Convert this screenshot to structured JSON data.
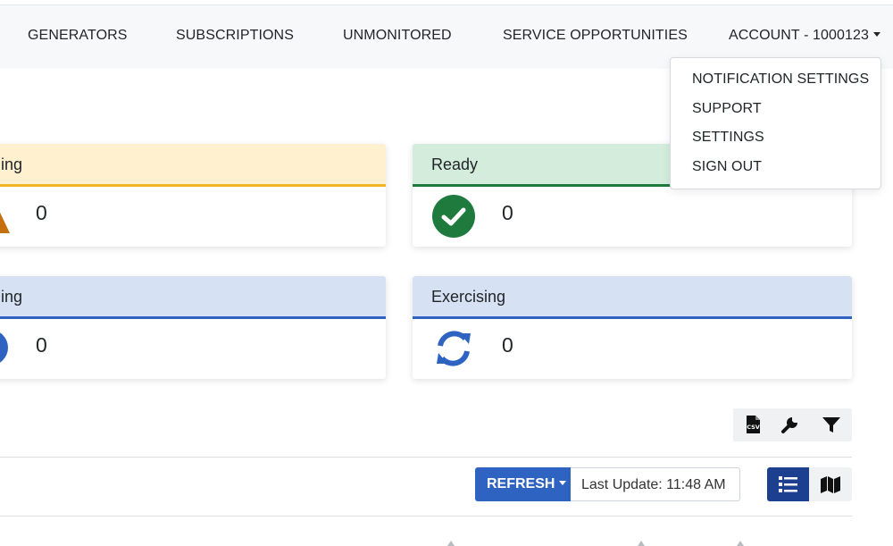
{
  "nav": {
    "generators": "GENERATORS",
    "subscriptions": "SUBSCRIPTIONS",
    "unmonitored": "UNMONITORED",
    "service_opportunities": "SERVICE OPPORTUNITIES",
    "account": "ACCOUNT - 1000123"
  },
  "account_menu": {
    "items": [
      "NOTIFICATION SETTINGS",
      "SUPPORT",
      "SETTINGS",
      "SIGN OUT"
    ]
  },
  "cards": {
    "warning": {
      "label": "ing",
      "value": "0",
      "icon": "warning-icon",
      "color": "#f0b429"
    },
    "ready": {
      "label": "Ready",
      "value": "0",
      "icon": "check-circle-icon",
      "color": "#1f7a3d"
    },
    "running": {
      "label": "ing",
      "value": "0",
      "icon": "circle-icon",
      "color": "#2f63c1"
    },
    "exercising": {
      "label": "Exercising",
      "value": "0",
      "icon": "sync-icon",
      "color": "#2f63c1"
    }
  },
  "toolbar": {
    "csv_icon_text": "CSV",
    "icons": [
      "csv-file-icon",
      "wrench-icon",
      "filter-icon"
    ]
  },
  "controls": {
    "refresh_label": "REFRESH",
    "last_update": "Last Update: 11:48 AM",
    "view_icons": [
      "list-icon",
      "map-icon"
    ]
  }
}
